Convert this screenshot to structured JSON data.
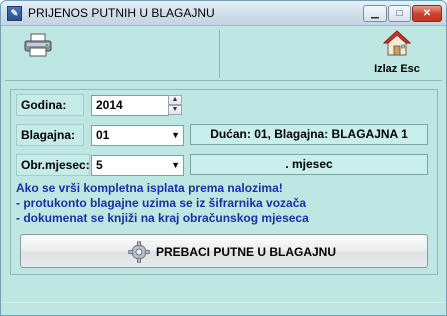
{
  "window": {
    "title": "PRIJENOS PUTNIH U BLAGAJNU",
    "app_icon": "app-icon"
  },
  "title_buttons": {
    "minimize": "▁",
    "maximize": "□",
    "close": "✕"
  },
  "toolbar": {
    "print_icon": "printer-icon",
    "exit": {
      "icon": "home-icon",
      "label": "Izlaz Esc"
    }
  },
  "form": {
    "godina": {
      "label": "Godina:",
      "value": "2014"
    },
    "blagajna": {
      "label": "Blagajna:",
      "value": "01",
      "info": "Dućan: 01, Blagajna: BLAGAJNA 1"
    },
    "mjesec": {
      "label": "Obr.mjesec:",
      "value": "5",
      "info": ". mjesec"
    }
  },
  "notes": [
    "Ako se vrši kompletna isplata prema nalozima!",
    " - protukonto blagajne uzima se iz šifrarnika vozača",
    " - dokumenat se knjiži na kraj obračunskog mjeseca"
  ],
  "action": {
    "label": "PREBACI PUTNE U BLAGAJNU",
    "icon": "gear-icon"
  },
  "colors": {
    "background": "#bfe7e2",
    "notes_text": "#1a2fa8",
    "close_button": "#c9402b"
  }
}
